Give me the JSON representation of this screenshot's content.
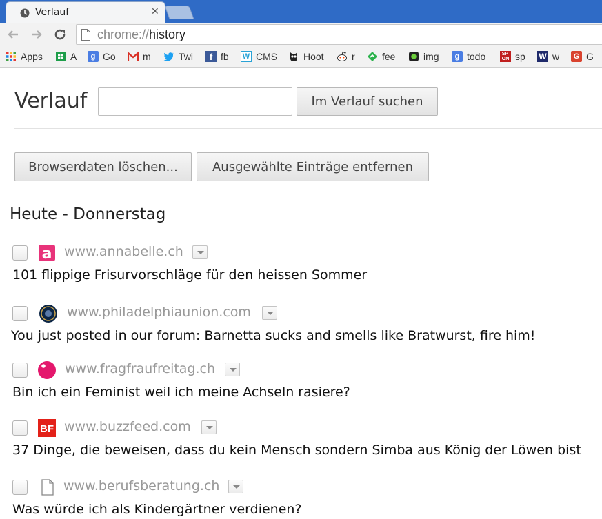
{
  "browser": {
    "tab": {
      "title": "Verlauf"
    },
    "url_scheme": "chrome://",
    "url_path": "history",
    "bookmarks": [
      {
        "label": "Apps",
        "icon": "apps-grid-icon"
      },
      {
        "label": "A",
        "icon": "sheets-icon"
      },
      {
        "label": "Go",
        "icon": "google-icon"
      },
      {
        "label": "m",
        "icon": "gmail-icon"
      },
      {
        "label": "Twi",
        "icon": "twitter-icon"
      },
      {
        "label": "fb",
        "icon": "facebook-icon"
      },
      {
        "label": "CMS",
        "icon": "wordpress-icon"
      },
      {
        "label": "Hoot",
        "icon": "hootsuite-icon"
      },
      {
        "label": "r",
        "icon": "reddit-icon"
      },
      {
        "label": "fee",
        "icon": "feedly-icon"
      },
      {
        "label": "img",
        "icon": "img-icon"
      },
      {
        "label": "todo",
        "icon": "google-icon"
      },
      {
        "label": "sp",
        "icon": "spon-icon"
      },
      {
        "label": "w",
        "icon": "w-icon"
      },
      {
        "label": "G",
        "icon": "google-plus-icon"
      }
    ]
  },
  "page": {
    "title": "Verlauf",
    "search": {
      "value": "",
      "placeholder": "",
      "button_label": "Im Verlauf suchen"
    },
    "actions": {
      "clear_label": "Browserdaten löschen...",
      "remove_label": "Ausgewählte Einträge entfernen"
    },
    "day_header": "Heute - Donnerstag",
    "entries": [
      {
        "domain": "www.annabelle.ch",
        "title": "101 flippige Frisurvorschläge für den heissen Sommer",
        "icon": "annabelle-icon"
      },
      {
        "domain": "www.philadelphiaunion.com",
        "title": "You just posted in our forum: Barnetta sucks and smells like Bratwurst, fire him!",
        "icon": "philadelphia-union-icon"
      },
      {
        "domain": "www.fragfraufreitag.ch",
        "title": "Bin ich ein Feminist weil ich meine Achseln rasiere?",
        "icon": "fragfraufreitag-icon"
      },
      {
        "domain": "www.buzzfeed.com",
        "title": "37 Dinge, die beweisen, dass du kein Mensch sondern Simba aus König der Löwen bist",
        "icon": "buzzfeed-icon"
      },
      {
        "domain": "www.berufsberatung.ch",
        "title": "Was würde ich als Kindergärtner verdienen?",
        "icon": "generic-page-icon"
      }
    ]
  },
  "colors": {
    "tabstrip": "#2f6bc6",
    "annabelle": "#e8337a",
    "fragfraufreitag": "#e4176c",
    "buzzfeed": "#e32119"
  }
}
